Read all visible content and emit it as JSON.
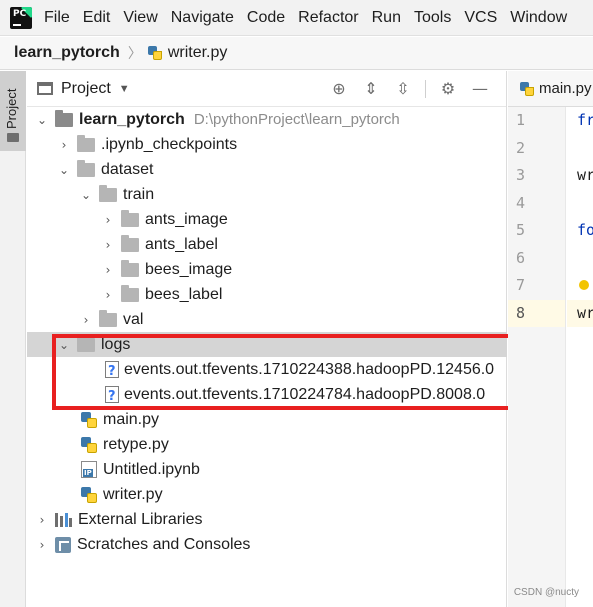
{
  "menu": {
    "items": [
      "File",
      "Edit",
      "View",
      "Navigate",
      "Code",
      "Refactor",
      "Run",
      "Tools",
      "VCS",
      "Window"
    ]
  },
  "breadcrumb": {
    "project": "learn_pytorch",
    "file": "writer.py"
  },
  "toolstrip": {
    "project_tab": "Project"
  },
  "panel": {
    "title": "Project",
    "tools": [
      "locate-icon",
      "expand-all-icon",
      "collapse-all-icon",
      "gear-icon",
      "hide-icon"
    ]
  },
  "tree": {
    "root": {
      "name": "learn_pytorch",
      "path": "D:\\pythonProject\\learn_pytorch"
    },
    "ipynb_checkpoints": ".ipynb_checkpoints",
    "dataset": "dataset",
    "train": "train",
    "ants_image": "ants_image",
    "ants_label": "ants_label",
    "bees_image": "bees_image",
    "bees_label": "bees_label",
    "val": "val",
    "logs": "logs",
    "event1": "events.out.tfevents.1710224388.hadoopPD.12456.0",
    "event2": "events.out.tfevents.1710224784.hadoopPD.8008.0",
    "main_py": "main.py",
    "retype_py": "retype.py",
    "untitled_ipynb": "Untitled.ipynb",
    "writer_py": "writer.py",
    "external_libraries": "External Libraries",
    "scratches": "Scratches and Consoles"
  },
  "editor": {
    "tab": "main.py",
    "line_numbers": [
      "1",
      "2",
      "3",
      "4",
      "5",
      "6",
      "7",
      "8"
    ],
    "code_fragments": [
      "fr",
      "",
      "wr",
      "",
      "fo",
      "",
      "",
      "wr"
    ]
  },
  "watermark": "CSDN @nucty",
  "colors": {
    "highlight": "#e82020",
    "selected_row": "#d5d5d5"
  }
}
